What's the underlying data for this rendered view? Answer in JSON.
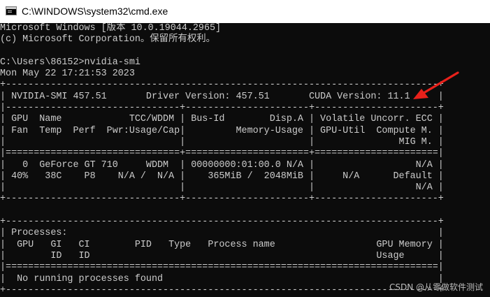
{
  "window": {
    "title": "C:\\WINDOWS\\system32\\cmd.exe",
    "icon": "cmd-app-icon"
  },
  "console": {
    "lines": [
      "Microsoft Windows [版本 10.0.19044.2965]",
      "(c) Microsoft Corporation。保留所有权利。",
      "",
      "C:\\Users\\86152>nvidia-smi",
      "Mon May 22 17:21:53 2023",
      "+-----------------------------------------------------------------------------+",
      "| NVIDIA-SMI 457.51       Driver Version: 457.51       CUDA Version: 11.1     |",
      "|-------------------------------+----------------------+----------------------+",
      "| GPU  Name            TCC/WDDM | Bus-Id        Disp.A | Volatile Uncorr. ECC |",
      "| Fan  Temp  Perf  Pwr:Usage/Cap|         Memory-Usage | GPU-Util  Compute M. |",
      "|                               |                      |               MIG M. |",
      "|===============================+======================+======================|",
      "|   0  GeForce GT 710     WDDM  | 00000000:01:00.0 N/A |                  N/A |",
      "| 40%   38C    P8    N/A /  N/A |    365MiB /  2048MiB |     N/A      Default |",
      "|                               |                      |                  N/A |",
      "+-------------------------------+----------------------+----------------------+",
      "",
      "+-----------------------------------------------------------------------------+",
      "| Processes:                                                                  |",
      "|  GPU   GI   CI        PID   Type   Process name                  GPU Memory |",
      "|        ID   ID                                                   Usage      |",
      "|=============================================================================|",
      "|  No running processes found                                                 |",
      "+-----------------------------------------------------------------------------+"
    ]
  },
  "annotation": {
    "arrow_color": "#e8211b"
  },
  "watermark": {
    "text": "CSDN @从零做软件测试"
  }
}
